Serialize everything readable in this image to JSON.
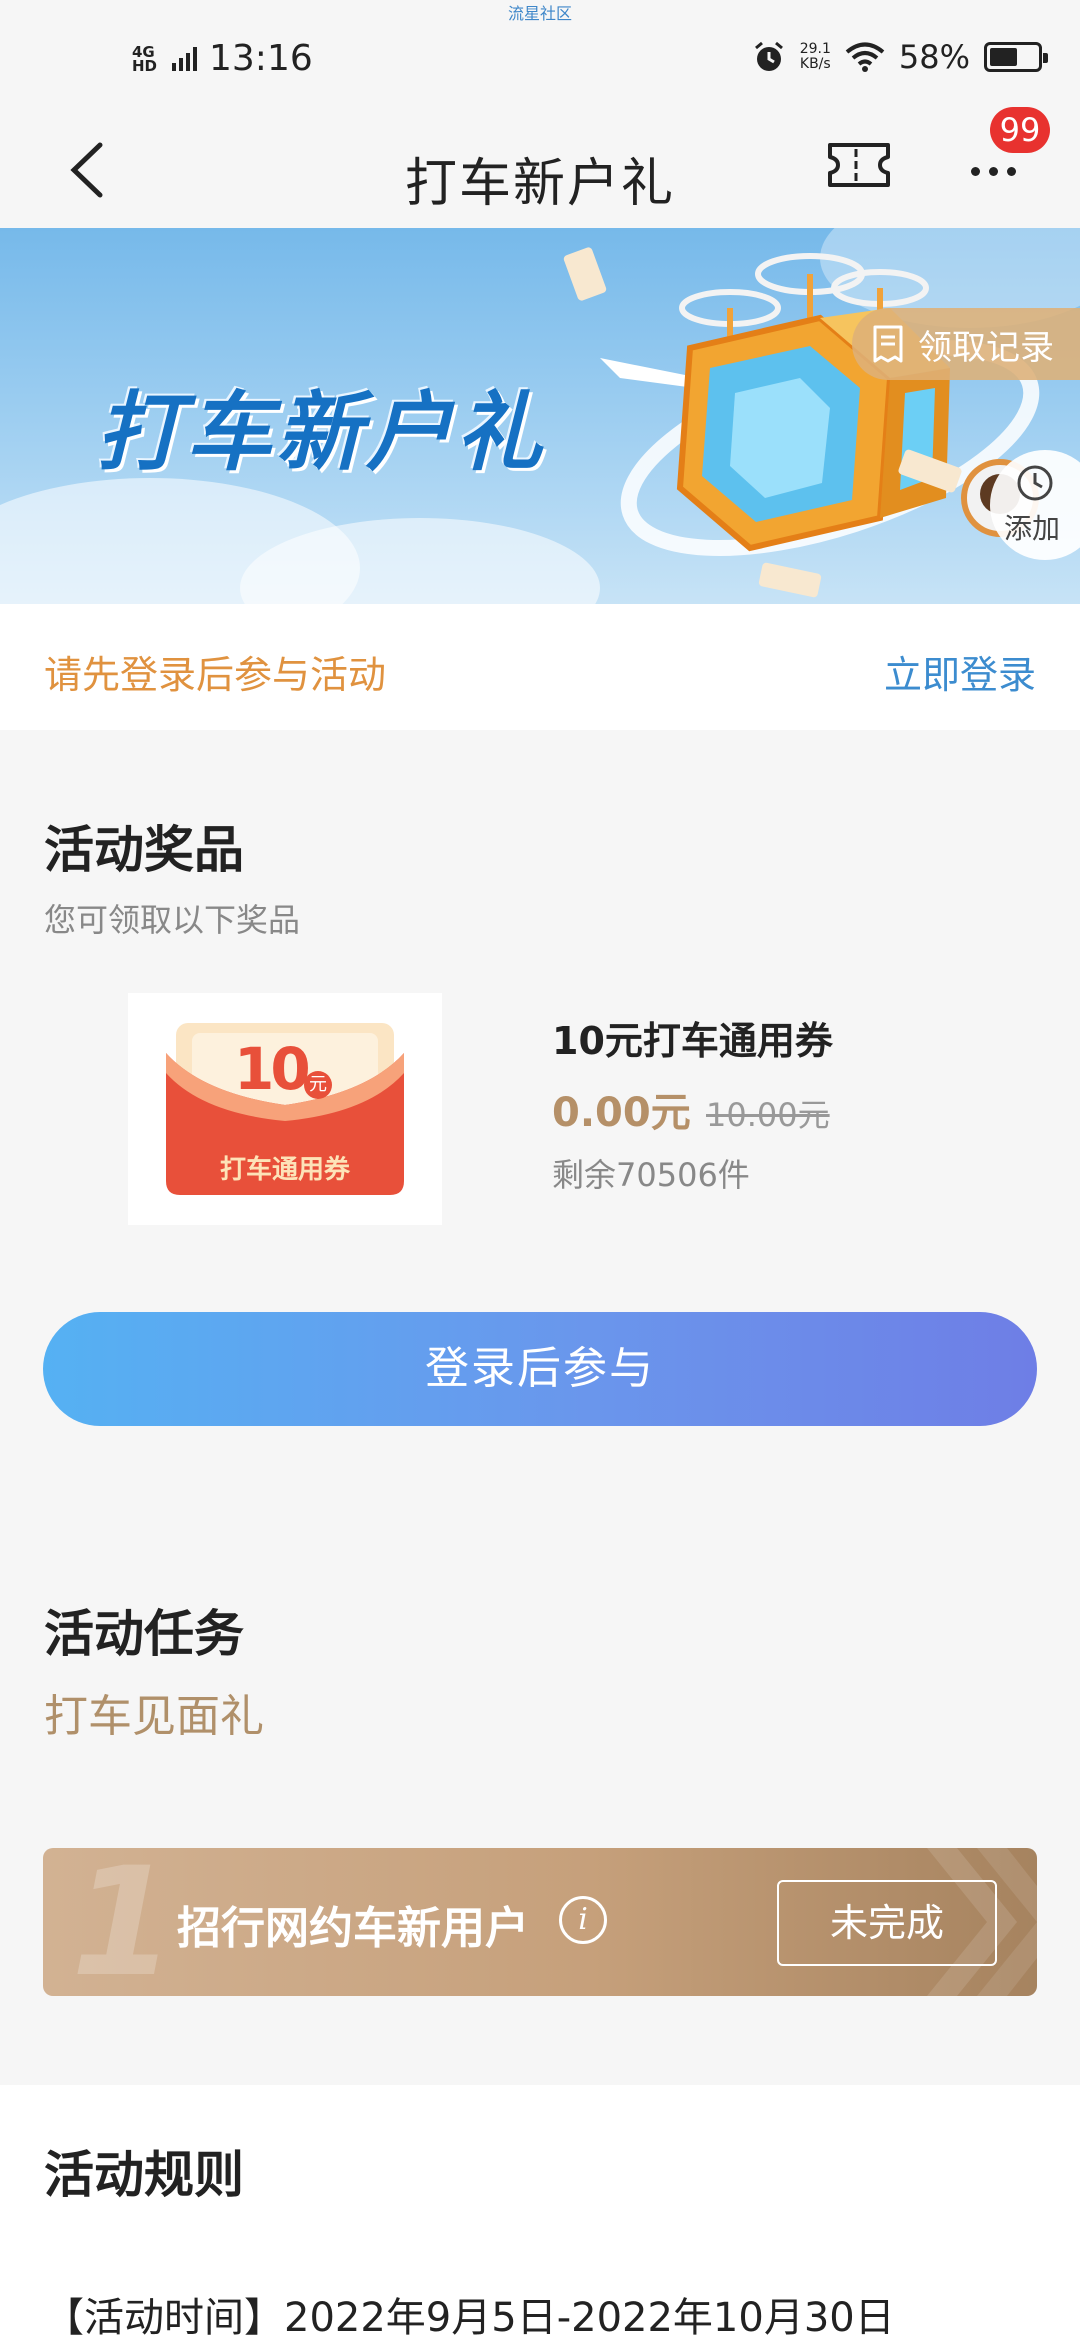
{
  "status_bar": {
    "watermark": "流星社区",
    "network": "4G HD",
    "time": "13:16",
    "speed_value": "29.1",
    "speed_unit": "KB/s",
    "battery": "58%",
    "battery_level": 0.58
  },
  "nav": {
    "title": "打车新户礼",
    "badge_count": "99"
  },
  "banner": {
    "title": "打车新户礼",
    "record_label": "领取记录",
    "add_label": "添加"
  },
  "login": {
    "prompt": "请先登录后参与活动",
    "link": "立即登录"
  },
  "prizes": {
    "title": "活动奖品",
    "subtitle": "您可领取以下奖品",
    "items": [
      {
        "coupon_amount": "10",
        "coupon_unit": "元",
        "coupon_text": "打车通用券",
        "name": "10元打车通用券",
        "price": "0.00元",
        "original_price": "10.00元",
        "stock": "剩余70506件"
      }
    ],
    "cta": "登录后参与"
  },
  "tasks": {
    "title": "活动任务",
    "group": "打车见面礼",
    "items": [
      {
        "number": "1",
        "label": "招行网约车新用户",
        "status": "未完成"
      }
    ]
  },
  "rules": {
    "title": "活动规则",
    "time_line": "【活动时间】2022年9月5日-2022年10月30日"
  },
  "colors": {
    "accent_blue": "#3c8ccf",
    "accent_orange": "#e0923f",
    "gold": "#b59068",
    "badge_red": "#e8322f"
  }
}
